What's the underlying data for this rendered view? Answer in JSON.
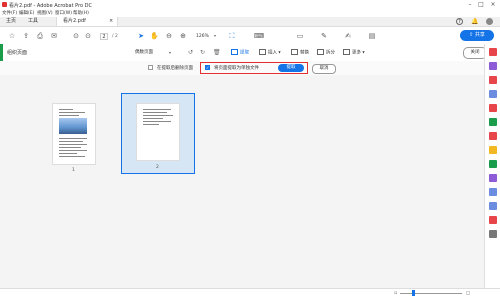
{
  "window": {
    "title": "看片2.pdf - Adobe Acrobat Pro DC"
  },
  "menu": [
    "文件(F)",
    "编辑(E)",
    "视图(V)",
    "窗口(W)",
    "帮助(H)"
  ],
  "tabs": {
    "home": "主页",
    "tools": "工具",
    "document": "看片2.pdf"
  },
  "toolbar": {
    "page_current": "2",
    "page_total": "/ 2",
    "zoom": "126%",
    "share_label": "共享"
  },
  "organize": {
    "title": "组织页面",
    "page_range": "偶数页面",
    "extract": "提取",
    "insert": "插入",
    "replace": "替换",
    "split": "拆分",
    "more": "更多",
    "close": "关闭"
  },
  "extract_bar": {
    "delete_after_extract": "在提取后删除页面",
    "delete_checked": false,
    "separate_files": "将页面提取为单独文件",
    "separate_checked": true,
    "extract_button": "提取",
    "cancel_button": "取消"
  },
  "pages": [
    {
      "label": "1",
      "selected": false
    },
    {
      "label": "2",
      "selected": true
    }
  ],
  "colors": {
    "accent": "#1473e6",
    "organize_green": "#1a9c4b",
    "highlight_red": "#e03030"
  },
  "icons": {
    "toolbar": [
      "new-icon",
      "upload-icon",
      "print-icon",
      "email-icon",
      "prev-page-icon",
      "next-page-icon",
      "select-cursor-icon",
      "hand-icon",
      "zoom-out-icon",
      "zoom-in-icon",
      "fit-page-icon",
      "comment-icon",
      "pen-icon",
      "sign-icon",
      "fill-sign-icon",
      "help-icon",
      "bell-icon",
      "avatar-icon"
    ]
  }
}
